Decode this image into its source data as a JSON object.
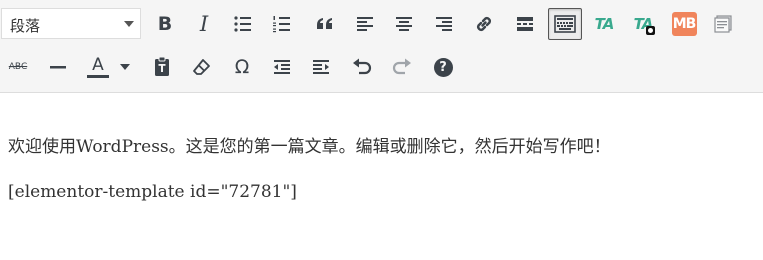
{
  "editor": {
    "format_select": {
      "value": "段落"
    },
    "toolbar_row1": [
      {
        "name": "bold-button",
        "icon": "bold-icon",
        "label": "B"
      },
      {
        "name": "italic-button",
        "icon": "italic-icon",
        "label": "I"
      },
      {
        "name": "bulleted-list-button",
        "icon": "bulleted-list-icon"
      },
      {
        "name": "numbered-list-button",
        "icon": "numbered-list-icon"
      },
      {
        "name": "blockquote-button",
        "icon": "quote-icon"
      },
      {
        "name": "align-left-button",
        "icon": "align-left-icon"
      },
      {
        "name": "align-center-button",
        "icon": "align-center-icon"
      },
      {
        "name": "align-right-button",
        "icon": "align-right-icon"
      },
      {
        "name": "insert-link-button",
        "icon": "link-icon"
      },
      {
        "name": "insert-more-button",
        "icon": "read-more-icon"
      },
      {
        "name": "toolbar-toggle-button",
        "icon": "keyboard-icon",
        "active": true
      },
      {
        "name": "ta-button",
        "icon": "ta-icon",
        "label": "TA"
      },
      {
        "name": "ta-plus-button",
        "icon": "ta-plus-icon",
        "label": "TA"
      },
      {
        "name": "mb-button",
        "icon": "mb-icon",
        "label": "MB"
      },
      {
        "name": "media-button",
        "icon": "media-icon"
      }
    ],
    "toolbar_row2": [
      {
        "name": "strikethrough-button",
        "icon": "strikethrough-icon",
        "label": "ABC"
      },
      {
        "name": "horizontal-line-button",
        "icon": "horizontal-line-icon"
      },
      {
        "name": "text-color-button",
        "icon": "text-color-icon",
        "label": "A"
      },
      {
        "name": "paste-text-button",
        "icon": "paste-icon"
      },
      {
        "name": "clear-formatting-button",
        "icon": "eraser-icon"
      },
      {
        "name": "special-character-button",
        "icon": "omega-icon",
        "label": "Ω"
      },
      {
        "name": "outdent-button",
        "icon": "outdent-icon"
      },
      {
        "name": "indent-button",
        "icon": "indent-icon"
      },
      {
        "name": "undo-button",
        "icon": "undo-icon"
      },
      {
        "name": "redo-button",
        "icon": "redo-icon",
        "disabled": true
      },
      {
        "name": "help-button",
        "icon": "help-icon",
        "label": "?"
      }
    ],
    "colors": {
      "toolbar_bg": "#f5f5f5",
      "icon": "#3c434a",
      "disabled_icon": "#a0a5aa",
      "ta_green": "#39a98e",
      "mb_orange": "#f0845b"
    },
    "content": {
      "paragraphs": [
        "欢迎使用WordPress。这是您的第一篇文章。编辑或删除它，然后开始写作吧！",
        "[elementor-template id=\"72781\"]"
      ]
    }
  }
}
